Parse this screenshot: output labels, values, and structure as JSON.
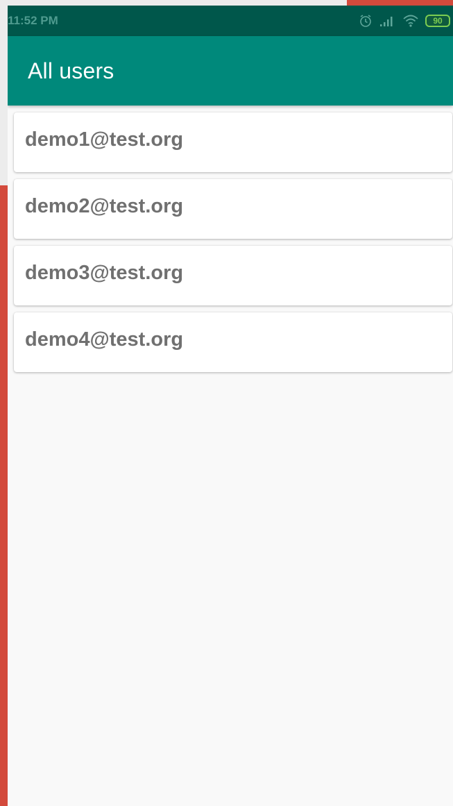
{
  "status_bar": {
    "time": "11:52 PM",
    "battery_level": "90",
    "icons": [
      "alarm-icon",
      "signal-icon",
      "wifi-icon",
      "battery-icon"
    ]
  },
  "app_bar": {
    "title": "All users",
    "color": "#00897b"
  },
  "users": [
    {
      "email": "demo1@test.org"
    },
    {
      "email": "demo2@test.org"
    },
    {
      "email": "demo3@test.org"
    },
    {
      "email": "demo4@test.org"
    }
  ],
  "colors": {
    "status_bar": "#00574b",
    "app_bar": "#00897b",
    "background": "#f9f9f9",
    "outer_background": "#d34a3c"
  }
}
